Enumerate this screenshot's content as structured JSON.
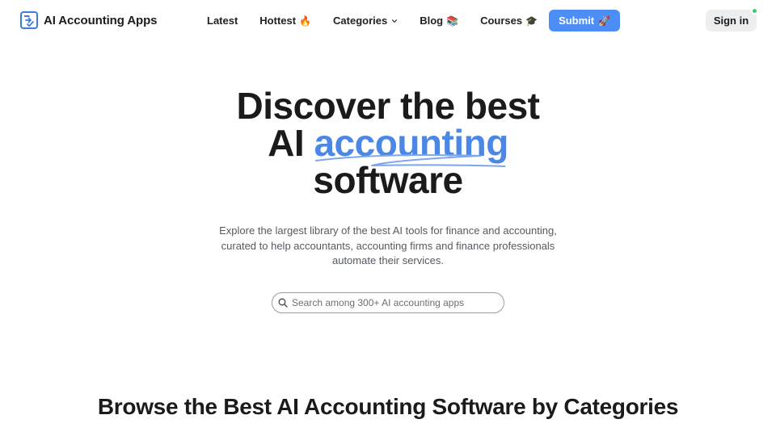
{
  "brand": {
    "name": "AI Accounting Apps"
  },
  "nav": {
    "latest": "Latest",
    "hottest": {
      "label": "Hottest",
      "emoji": "🔥"
    },
    "categories": "Categories",
    "blog": {
      "label": "Blog",
      "emoji": "📚"
    },
    "courses": {
      "label": "Courses",
      "emoji": "🎓"
    },
    "submit": {
      "label": "Submit",
      "emoji": "🚀"
    },
    "signin": "Sign in"
  },
  "hero": {
    "line1": "Discover the best",
    "line2_prefix": "AI ",
    "line2_accent": "accounting",
    "line3": "software",
    "subtitle_l1": "Explore the largest library of the best AI tools for finance and accounting,",
    "subtitle_l2": "curated to help accountants, accounting firms and finance professionals",
    "subtitle_l3": "automate their services."
  },
  "search": {
    "placeholder": "Search among 300+ AI accounting apps"
  },
  "section": {
    "title": "Browse the Best AI Accounting Software by Categories"
  },
  "colors": {
    "accent": "#4b87e6",
    "submit_bg": "#4c8ef5",
    "online": "#39d06a",
    "signin_bg": "#eceef0"
  },
  "icons": {
    "brand": "app-logo-icon",
    "categories": "chevron-down-icon",
    "search": "search-icon",
    "status": "online-status-dot"
  }
}
